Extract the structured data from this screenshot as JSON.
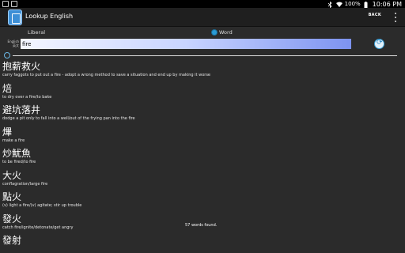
{
  "status_bar": {
    "battery": "100%",
    "time": "10:06 PM"
  },
  "action_bar": {
    "title": "Lookup English",
    "back_label": "BACK"
  },
  "mode": {
    "options": [
      {
        "label": "Liberal",
        "selected": false
      },
      {
        "label": "Word",
        "selected": true
      }
    ]
  },
  "search": {
    "language_label_line1": "English",
    "language_label_line2": "英文",
    "value": "fire"
  },
  "results": [
    {
      "term": "抱薪救火",
      "definition": "carry faggots to put out a fire - adopt a wrong method to save a situation and end up by making it worse"
    },
    {
      "term": "焙",
      "definition": "to dry over a fire/to bake"
    },
    {
      "term": "避坑落井",
      "definition": "dodge a pit only to fall into a well/out of the frying pan into the fire"
    },
    {
      "term": "熚",
      "definition": "make a fire"
    },
    {
      "term": "炒魷魚",
      "definition": "to be fired/to fire"
    },
    {
      "term": "大火",
      "definition": "conflagration/large fire"
    },
    {
      "term": "點火",
      "definition": "(v) light a fire/(v) agitate; stir up trouble"
    },
    {
      "term": "發火",
      "definition": "catch fire/ignite/detonate/get angry"
    },
    {
      "term": "發射",
      "definition": ""
    }
  ],
  "toast": "57 words found.",
  "colors": {
    "accent": "#2a9bd6",
    "background": "#2b2b2b",
    "action_bar": "#1f1f1f"
  }
}
